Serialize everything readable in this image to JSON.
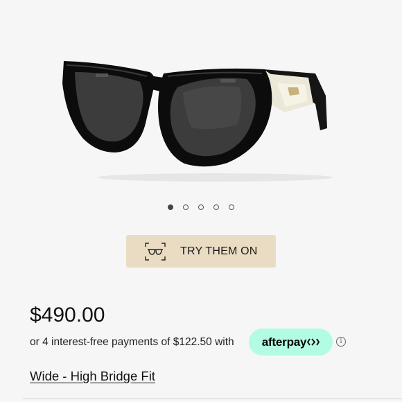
{
  "product": {
    "image_icon": "sunglasses-image",
    "carousel": {
      "total": 5,
      "active": 1
    }
  },
  "try_on": {
    "label": "TRY THEM ON",
    "icon": "glasses-scan-icon"
  },
  "pricing": {
    "price": "$490.00",
    "installments": "or 4 interest-free payments of $122.50 with",
    "afterpay_label": "afterpay",
    "afterpay_icon": "afterpay-arrows-icon",
    "afterpay_color": "#b2fce4",
    "info_icon": "info-icon"
  },
  "fit": {
    "label": "Wide - High Bridge Fit"
  },
  "colors": {
    "background": "#f6f6f6",
    "try_on_button": "#e9dcc3"
  }
}
